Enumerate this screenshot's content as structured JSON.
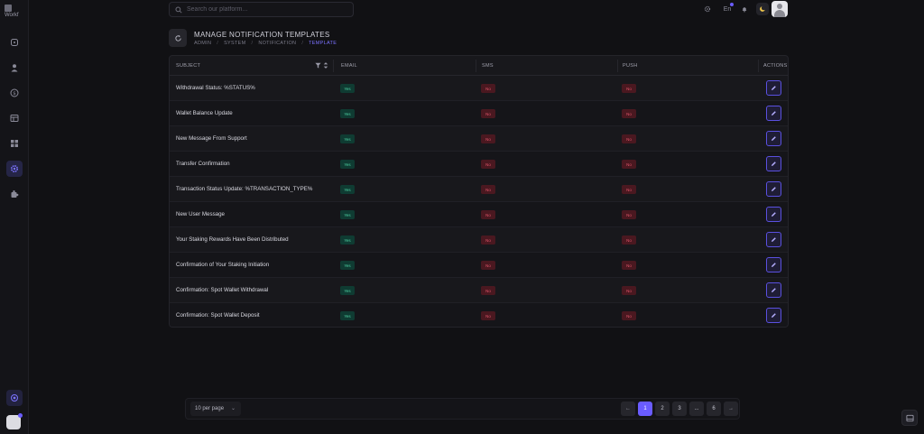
{
  "app": {
    "logo_text": "Workf"
  },
  "search": {
    "placeholder": "Search our platform..."
  },
  "topbar": {
    "language": "En"
  },
  "header": {
    "title": "MANAGE NOTIFICATION TEMPLATES",
    "breadcrumb": [
      "ADMIN",
      "SYSTEM",
      "NOTIFICATION",
      "TEMPLATE"
    ]
  },
  "table": {
    "columns": {
      "subject": "SUBJECT",
      "email": "EMAIL",
      "sms": "SMS",
      "push": "PUSH",
      "actions": "ACTIONS"
    },
    "rows": [
      {
        "subject": "Withdrawal Status: %STATUS%",
        "email": "Yes",
        "sms": "No",
        "push": "No"
      },
      {
        "subject": "Wallet Balance Update",
        "email": "Yes",
        "sms": "No",
        "push": "No"
      },
      {
        "subject": "New Message From Support",
        "email": "Yes",
        "sms": "No",
        "push": "No"
      },
      {
        "subject": "Transfer Confirmation",
        "email": "Yes",
        "sms": "No",
        "push": "No"
      },
      {
        "subject": "Transaction Status Update: %TRANSACTION_TYPE%",
        "email": "Yes",
        "sms": "No",
        "push": "No"
      },
      {
        "subject": "New User Message",
        "email": "Yes",
        "sms": "No",
        "push": "No"
      },
      {
        "subject": "Your Staking Rewards Have Been Distributed",
        "email": "Yes",
        "sms": "No",
        "push": "No"
      },
      {
        "subject": "Confirmation of Your Staking Initiation",
        "email": "Yes",
        "sms": "No",
        "push": "No"
      },
      {
        "subject": "Confirmation: Spot Wallet Withdrawal",
        "email": "Yes",
        "sms": "No",
        "push": "No"
      },
      {
        "subject": "Confirmation: Spot Wallet Deposit",
        "email": "Yes",
        "sms": "No",
        "push": "No"
      }
    ]
  },
  "pagination": {
    "per_page": "10 per page",
    "pages": [
      "1",
      "2",
      "3",
      "...",
      "6"
    ],
    "current_page": "1",
    "prev_icon": "arrow-left-icon",
    "next_icon": "arrow-right-icon"
  },
  "colors": {
    "accent": "#6a5cff",
    "yes_bg": "#0f3b32",
    "no_bg": "#4a1820"
  }
}
